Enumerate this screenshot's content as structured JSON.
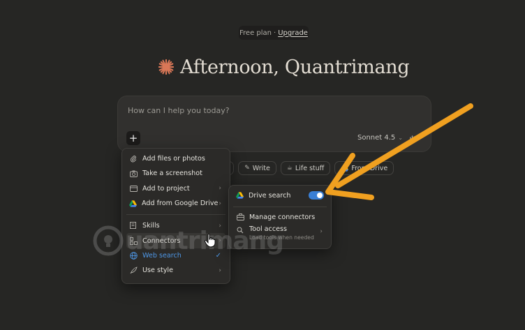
{
  "header": {
    "plan_label": "Free plan",
    "separator": "·",
    "upgrade_label": "Upgrade"
  },
  "greeting": {
    "text": "Afternoon, Quantrimang",
    "logo_icon": "claude-starburst-icon",
    "logo_color": "#d97757"
  },
  "composer": {
    "placeholder": "How can I help you today?",
    "plus_label": "+",
    "model": "Sonnet 4.5"
  },
  "chips": [
    {
      "label": "Write",
      "icon": "pen-icon"
    },
    {
      "label": "Life stuff",
      "icon": "coffee-icon"
    },
    {
      "label": "From Drive",
      "icon": "google-drive-icon"
    }
  ],
  "menu": {
    "items": [
      {
        "label": "Add files or photos",
        "icon": "paperclip-icon"
      },
      {
        "label": "Take a screenshot",
        "icon": "camera-icon"
      },
      {
        "label": "Add to project",
        "icon": "folder-icon",
        "has_submenu": true
      },
      {
        "label": "Add from Google Drive",
        "icon": "google-drive-icon",
        "has_submenu": true
      },
      {
        "label": "Skills",
        "icon": "skills-icon",
        "has_submenu": true
      },
      {
        "label": "Connectors",
        "icon": "connectors-icon",
        "has_submenu": true,
        "highlighted": true
      },
      {
        "label": "Web search",
        "icon": "globe-icon",
        "checked": true
      },
      {
        "label": "Use style",
        "icon": "quill-icon",
        "has_submenu": true
      }
    ]
  },
  "connectors_submenu": {
    "drive_search": {
      "label": "Drive search",
      "icon": "google-drive-icon",
      "enabled": true
    },
    "manage": {
      "label": "Manage connectors",
      "icon": "briefcase-icon"
    },
    "tool_access": {
      "label": "Tool access",
      "sublabel": "Load tools when needed",
      "icon": "search-icon"
    }
  },
  "watermark": {
    "text": "uantrimang"
  },
  "colors": {
    "background": "#262624",
    "accent_blue": "#4e97e6",
    "toggle_on": "#3a7fd5",
    "annotation_arrow": "#f0a020"
  }
}
